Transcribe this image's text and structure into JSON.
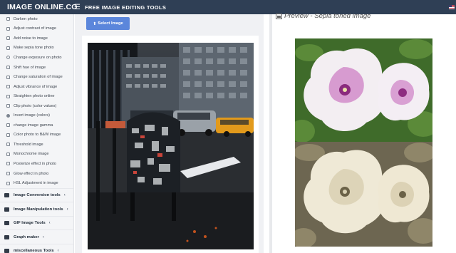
{
  "header": {
    "logo": "IMAGE ONLINE.CO",
    "menu_icon": "hamburger-icon",
    "title": "FREE IMAGE EDITING TOOLS",
    "flag_icon": "us-flag-icon"
  },
  "sidebar": {
    "items": [
      {
        "label": "Darken photo",
        "icon": "image-icon"
      },
      {
        "label": "Adjust contrast of image",
        "icon": "image-icon"
      },
      {
        "label": "Add noise to image",
        "icon": "image-icon"
      },
      {
        "label": "Make sepia tone photo",
        "icon": "image-icon"
      },
      {
        "label": "Change exposure on photo",
        "icon": "circle-icon"
      },
      {
        "label": "Shift hue of image",
        "icon": "image-icon"
      },
      {
        "label": "Change saturation of image",
        "icon": "image-icon"
      },
      {
        "label": "Adjust vibrance of image",
        "icon": "image-icon"
      },
      {
        "label": "Straighten photo online",
        "icon": "image-icon"
      },
      {
        "label": "Clip photo (color values)",
        "icon": "image-icon"
      },
      {
        "label": "Invert image (colors)",
        "icon": "invert-icon"
      },
      {
        "label": "change image gamma",
        "icon": "image-icon"
      },
      {
        "label": "Color photo to B&W image",
        "icon": "image-icon"
      },
      {
        "label": "Threshold image",
        "icon": "image-icon"
      },
      {
        "label": "Monochrome image",
        "icon": "image-icon"
      },
      {
        "label": "Posterize effect in photo",
        "icon": "image-icon"
      },
      {
        "label": "Glow effect in photo",
        "icon": "image-icon"
      },
      {
        "label": "HSL Adjustment in image",
        "icon": "image-icon"
      }
    ],
    "sections": [
      {
        "label": "Image Conversion tools",
        "icon": "convert-icon"
      },
      {
        "label": "Image Manipulation tools",
        "icon": "wrench-icon"
      },
      {
        "label": "GIF Image Tools",
        "icon": "gif-icon"
      },
      {
        "label": "Graph maker",
        "icon": "chart-icon"
      },
      {
        "label": "miscellaneous Tools",
        "icon": "tools-icon"
      }
    ],
    "arrow": "‹"
  },
  "upload": {
    "button_label": "Select Image",
    "button_icon": "upload-icon"
  },
  "preview": {
    "title": "Preview - Sepia toned image",
    "title_icon": "image-icon"
  },
  "colors": {
    "header_bg": "#2f3f55",
    "button_bg": "#5b86db",
    "sidebar_bg": "#f4f5f7"
  }
}
